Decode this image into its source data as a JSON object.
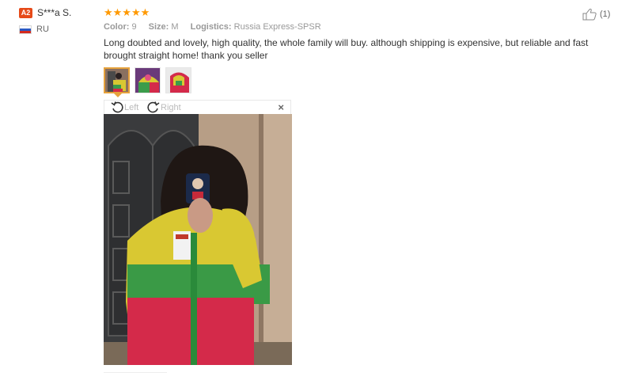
{
  "reviewer": {
    "badge": "A2",
    "name": "S***a S.",
    "country": "RU"
  },
  "review": {
    "stars": "★★★★★",
    "color_label": "Color:",
    "color_value": "9",
    "size_label": "Size:",
    "size_value": "M",
    "logistics_label": "Logistics:",
    "logistics_value": "Russia Express-SPSR",
    "text": "Long doubted and lovely, high quality, the whole family will buy. although shipping is expensive, but reliable and fast brought straight home! thank you seller"
  },
  "helpful": {
    "count": "(1)"
  },
  "viewer": {
    "rotate_left": "Left",
    "rotate_right": "Right",
    "close": "×"
  },
  "icons": {
    "like": "thumbs-up-icon",
    "rotate_left": "rotate-left-icon",
    "rotate_right": "rotate-right-icon",
    "close": "close-icon"
  },
  "colors": {
    "badge": "#e64a19",
    "stars": "#ff9900",
    "thumb_active_border": "#e6a23c"
  }
}
